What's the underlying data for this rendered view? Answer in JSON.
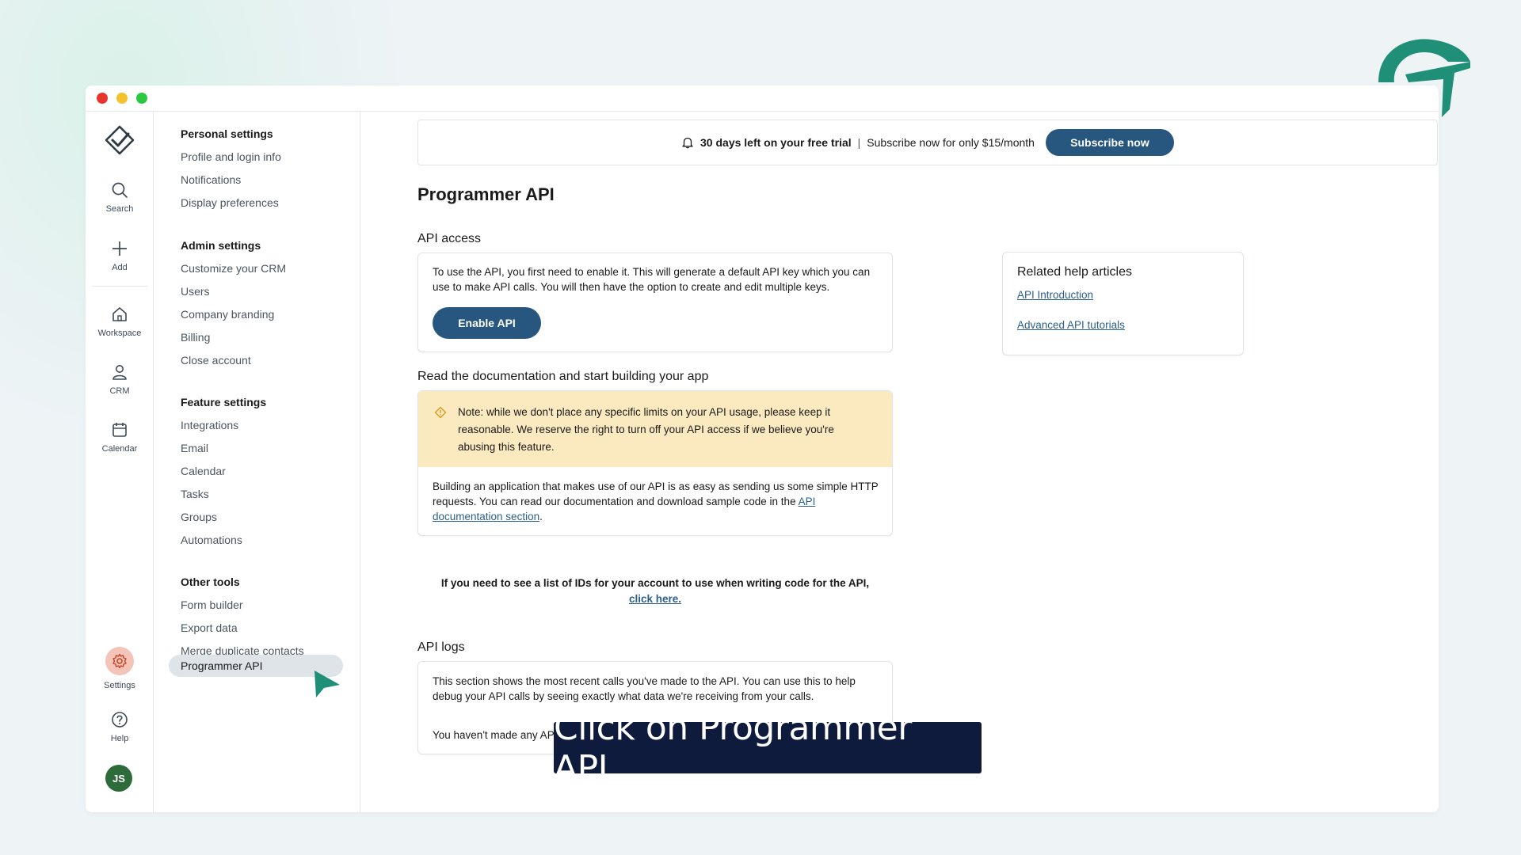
{
  "sidebar_rail": {
    "items": [
      {
        "label": "Search",
        "icon": "search-icon"
      },
      {
        "label": "Add",
        "icon": "plus-icon"
      },
      {
        "label": "Workspace",
        "icon": "home-icon"
      },
      {
        "label": "CRM",
        "icon": "person-icon"
      },
      {
        "label": "Calendar",
        "icon": "calendar-icon"
      },
      {
        "label": "Settings",
        "icon": "gear-icon"
      },
      {
        "label": "Help",
        "icon": "help-icon"
      }
    ],
    "avatar_initials": "JS"
  },
  "settings_nav": {
    "personal": {
      "title": "Personal settings",
      "items": [
        "Profile and login info",
        "Notifications",
        "Display preferences"
      ]
    },
    "admin": {
      "title": "Admin settings",
      "items": [
        "Customize your CRM",
        "Users",
        "Company branding",
        "Billing",
        "Close account"
      ]
    },
    "feature": {
      "title": "Feature settings",
      "items": [
        "Integrations",
        "Email",
        "Calendar",
        "Tasks",
        "Groups",
        "Automations"
      ]
    },
    "other": {
      "title": "Other tools",
      "items": [
        "Form builder",
        "Export data",
        "Merge duplicate contacts",
        "Programmer API"
      ]
    },
    "active_item": "Programmer API"
  },
  "trial_banner": {
    "bold_text": "30 days left on your free trial",
    "separator": "|",
    "text": "Subscribe now for only $15/month",
    "button_label": "Subscribe now"
  },
  "main": {
    "title": "Programmer API",
    "api_access": {
      "heading": "API access",
      "body": "To use the API, you first need to enable it. This will generate a default API key which you can use to make API calls. You will then have the option to create and edit multiple keys.",
      "button_label": "Enable API"
    },
    "help": {
      "title": "Related help articles",
      "links": [
        "API Introduction",
        "Advanced API tutorials"
      ]
    },
    "docs": {
      "heading": "Read the documentation and start building your app",
      "note": "Note: while we don't place any specific limits on your API usage, please keep it reasonable. We reserve the right to turn off your API access if we believe you're abusing this feature.",
      "body": "Building an application that makes use of our API is as easy as sending us some simple HTTP requests. You can read our documentation and download sample code in the ",
      "link": "API documentation section",
      "body_end": "."
    },
    "ids_note": {
      "text": "If you need to see a list of IDs for your account to use when writing code for the API,",
      "link": "click here."
    },
    "logs": {
      "heading": "API logs",
      "body": "This section shows the most recent calls you've made to the API. You can use this to help debug your API calls by seeing exactly what data we're receiving from your calls.",
      "empty": "You haven't made any API calls yet."
    }
  },
  "caption": "Click on Programmer API.",
  "colors": {
    "primary": "#27567f",
    "note_bg": "#fbe9c0",
    "brand_teal": "#1f8f78",
    "caption_bg": "#0f1b3d"
  }
}
